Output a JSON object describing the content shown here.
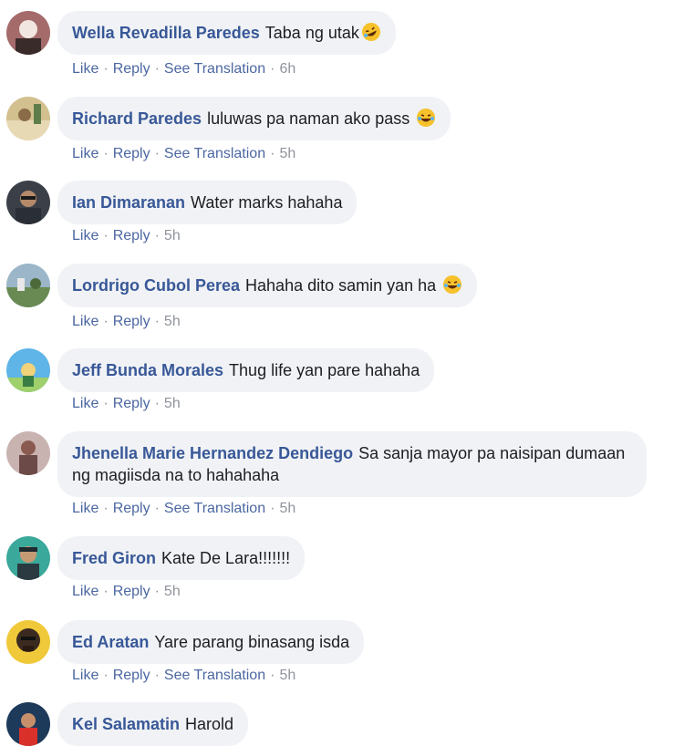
{
  "actions": {
    "like": "Like",
    "reply": "Reply",
    "see_translation": "See Translation",
    "separator": "·"
  },
  "comments": [
    {
      "author": "Wella Revadilla Paredes",
      "text": "Taba ng utak",
      "emoji": "rofl",
      "time": "6h",
      "translation": true
    },
    {
      "author": "Richard Paredes",
      "text": "luluwas pa naman ako pass ",
      "emoji": "joy",
      "time": "5h",
      "translation": true
    },
    {
      "author": "Ian Dimaranan",
      "text": "Water marks hahaha",
      "emoji": "",
      "time": "5h",
      "translation": false
    },
    {
      "author": "Lordrigo Cubol Perea",
      "text": "Hahaha dito samin yan ha ",
      "emoji": "joy",
      "time": "5h",
      "translation": false
    },
    {
      "author": "Jeff Bunda Morales",
      "text": "Thug life yan pare hahaha",
      "emoji": "",
      "time": "5h",
      "translation": false
    },
    {
      "author": "Jhenella Marie Hernandez Dendiego",
      "text": "Sa sanja mayor pa naisipan dumaan ng magiisda na to hahahaha",
      "emoji": "",
      "time": "5h",
      "translation": true
    },
    {
      "author": "Fred Giron",
      "text": "Kate De Lara!!!!!!!",
      "emoji": "",
      "time": "5h",
      "translation": false
    },
    {
      "author": "Ed Aratan",
      "text": "Yare parang binasang isda",
      "emoji": "",
      "time": "5h",
      "translation": true
    },
    {
      "author": "Kel Salamatin",
      "text": "Harold",
      "emoji": "",
      "time": "",
      "translation": false
    }
  ]
}
